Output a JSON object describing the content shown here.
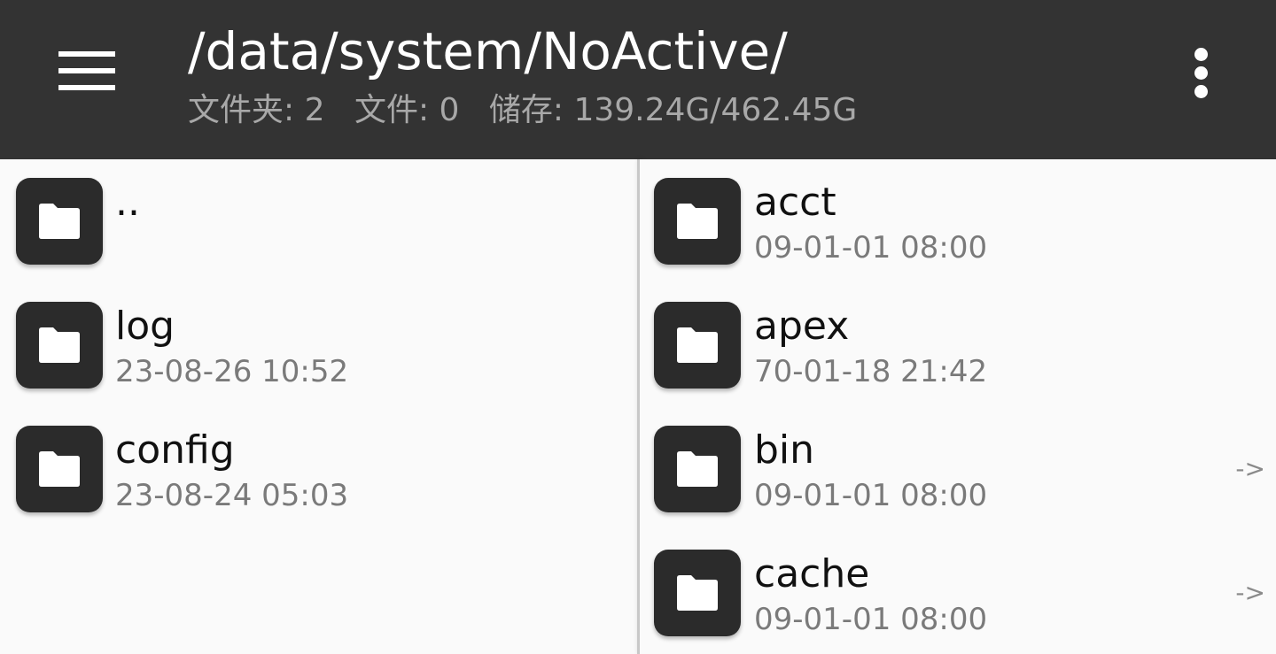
{
  "header": {
    "path": "/data/system/NoActive/",
    "folders_stat": "文件夹: 2",
    "files_stat": "文件: 0",
    "storage_stat": "储存: 139.24G/462.45G",
    "menu_icon": "hamburger-menu-icon",
    "more_icon": "vertical-dots-icon"
  },
  "left_pane": {
    "items": [
      {
        "name": "..",
        "date": ""
      },
      {
        "name": "log",
        "date": "23-08-26 10:52"
      },
      {
        "name": "config",
        "date": "23-08-24 05:03"
      }
    ]
  },
  "right_pane": {
    "items": [
      {
        "name": "acct",
        "date": "09-01-01 08:00",
        "link": ""
      },
      {
        "name": "apex",
        "date": "70-01-18 21:42",
        "link": ""
      },
      {
        "name": "bin",
        "date": "09-01-01 08:00",
        "link": "->"
      },
      {
        "name": "cache",
        "date": "09-01-01 08:00",
        "link": "->"
      }
    ]
  },
  "colors": {
    "topbar": "#333333",
    "folder_tile": "#2b2b2b",
    "background": "#fafafa"
  }
}
